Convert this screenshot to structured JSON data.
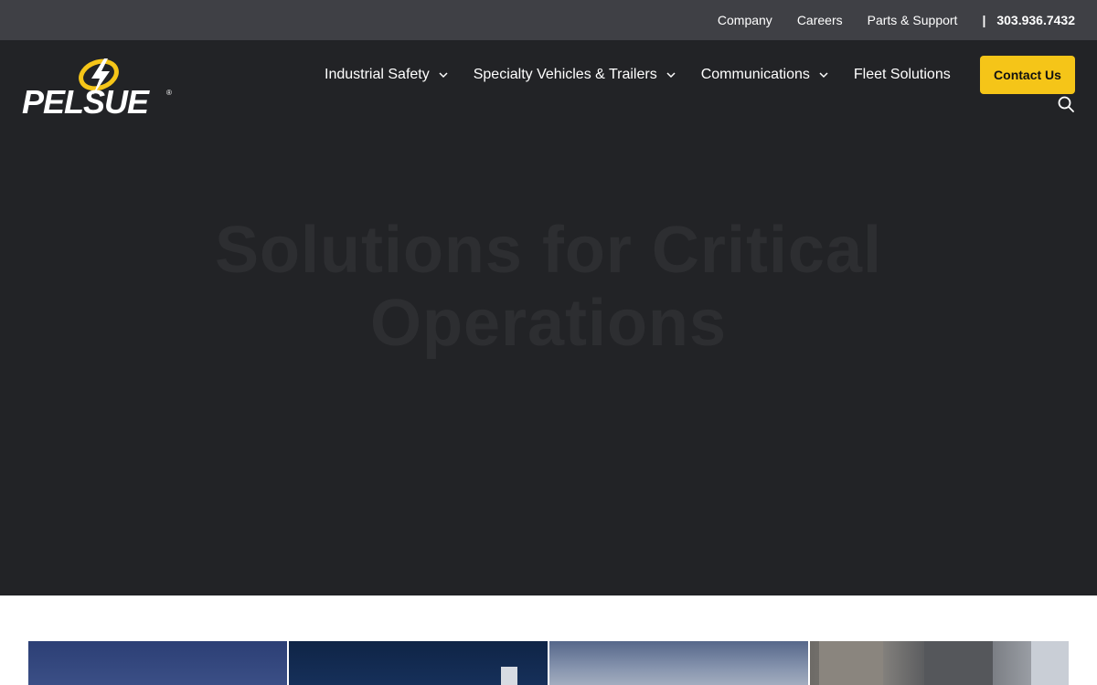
{
  "topbar": {
    "links": [
      "Company",
      "Careers",
      "Parts & Support"
    ],
    "separator": "|",
    "phone": "303.936.7432"
  },
  "logo": {
    "text": "PELSUE",
    "registered": "®"
  },
  "nav": {
    "items": [
      {
        "label": "Industrial Safety",
        "dropdown": true
      },
      {
        "label": "Specialty Vehicles & Trailers",
        "dropdown": true
      },
      {
        "label": "Communications",
        "dropdown": true
      },
      {
        "label": "Fleet Solutions",
        "dropdown": false
      }
    ],
    "contact_label": "Contact Us"
  },
  "hero": {
    "title": "Solutions for Critical Operations"
  },
  "colors": {
    "accent": "#f5c518",
    "topbar_bg": "#3f4045",
    "hero_bg": "#222326"
  },
  "icons": [
    "chevron-down-icon",
    "search-icon",
    "pelsue-logo"
  ]
}
